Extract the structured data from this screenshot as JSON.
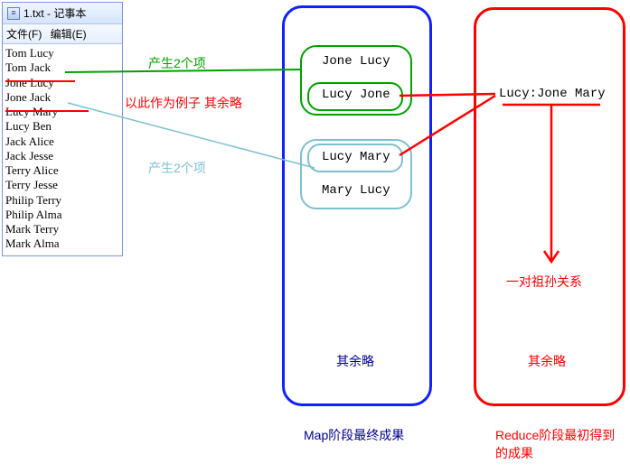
{
  "notepad": {
    "icon_glyph": "≡",
    "title": "1.txt - 记事本",
    "menu_file": "文件(F)",
    "menu_edit": "编辑(E)",
    "lines": "Tom Lucy\nTom Jack\nJone Lucy\nJone Jack\nLucy Mary\nLucy Ben\nJack Alice\nJack Jesse\nTerry Alice\nTerry Jesse\nPhilip Terry\nPhilip Alma\nMark Terry\nMark Alma"
  },
  "map_items": {
    "i1": "Jone Lucy",
    "i2": "Lucy Jone",
    "i3": "Lucy Mary",
    "i4": "Mary Lucy"
  },
  "reduce_output": "Lucy:Jone Mary",
  "labels": {
    "green_note": "产生2个项",
    "example_note": "以此作为例子   其余略",
    "cyan_note": "产生2个项",
    "rest_omitted": "其余略",
    "grandparent": "一对祖孙关系",
    "map_caption": "Map阶段最终成果",
    "reduce_caption": "Reduce阶段最初得到的成果"
  }
}
